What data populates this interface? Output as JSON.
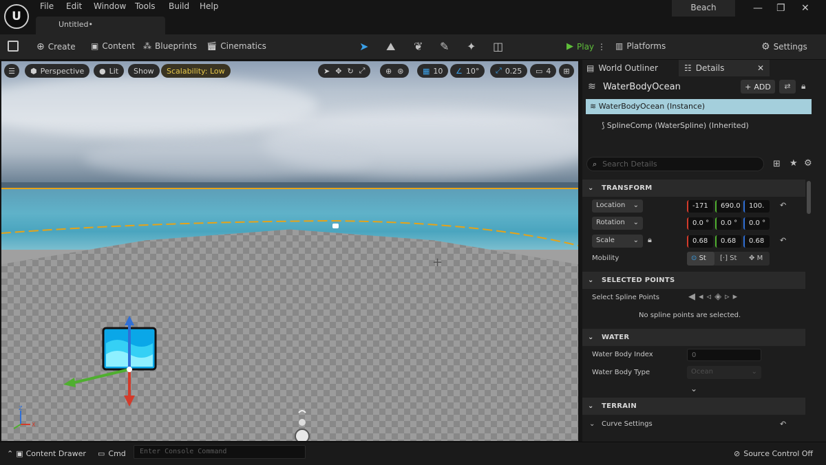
{
  "window": {
    "logo_text": "U",
    "menu": [
      "File",
      "Edit",
      "Window",
      "Tools",
      "Build",
      "Help"
    ],
    "tab_title": "Untitled•",
    "project_name": "Beach",
    "controls": [
      "—",
      "❐",
      "✕"
    ]
  },
  "toolbar": {
    "create": "Create",
    "content": "Content",
    "blueprints": "Blueprints",
    "cinematics": "Cinematics",
    "play": "Play",
    "platforms": "Platforms",
    "settings": "Settings"
  },
  "viewport": {
    "perspective": "Perspective",
    "lit": "Lit",
    "show": "Show",
    "scalability": "Scalability: Low",
    "grid_snap": "10",
    "rotation_snap": "10°",
    "scale_snap": "0.25",
    "camera_speed": "4",
    "axis_labels": {
      "z": "Z",
      "x": "X"
    }
  },
  "panel": {
    "tab_outliner": "World Outliner",
    "tab_details": "Details",
    "object_name": "WaterBodyOcean",
    "add_label": "ADD",
    "component_instance": "WaterBodyOcean (Instance)",
    "component_spline": "SplineComp (WaterSpline) (Inherited)",
    "search_placeholder": "Search Details",
    "sections": {
      "transform": "TRANSFORM",
      "selected_points": "SELECTED POINTS",
      "water": "WATER",
      "terrain": "TERRAIN"
    },
    "transform": {
      "location_label": "Location",
      "location": [
        "-171",
        "690.0",
        "100."
      ],
      "rotation_label": "Rotation",
      "rotation": [
        "0.0 °",
        "0.0 °",
        "0.0 °"
      ],
      "scale_label": "Scale",
      "scale": [
        "0.68",
        "0.68",
        "0.68"
      ],
      "mobility_label": "Mobility",
      "mobility_options": [
        "St",
        "St",
        "M"
      ]
    },
    "selected_points": {
      "label": "Select Spline Points",
      "message": "No spline points are selected."
    },
    "water": {
      "index_label": "Water Body Index",
      "index_value": "0",
      "type_label": "Water Body Type",
      "type_value": "Ocean"
    },
    "terrain": {
      "curve_settings": "Curve Settings"
    }
  },
  "statusbar": {
    "content_drawer": "Content Drawer",
    "cmd": "Cmd",
    "console_placeholder": "Enter Console Command",
    "source_control": "Source Control Off"
  },
  "colors": {
    "accent_play": "#5fbf3a",
    "selection": "#a4cfdc",
    "scalability": "#e6c84a",
    "axis_x": "#d33b2b",
    "axis_y": "#4faf2f",
    "axis_z": "#2f6fd6"
  }
}
